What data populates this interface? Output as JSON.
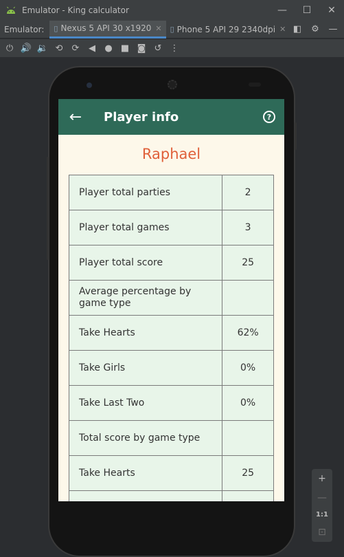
{
  "window": {
    "title": "Emulator - King calculator",
    "minimize_glyph": "—",
    "maximize_glyph": "☐",
    "close_glyph": "✕"
  },
  "tabs_bar": {
    "label": "Emulator:",
    "tabs": [
      {
        "label": "Nexus 5 API 30 x1920",
        "active": true
      },
      {
        "label": "Phone 5 API 29 2340dpi",
        "active": false
      }
    ],
    "close_glyph": "✕"
  },
  "toolbar": {
    "icons": [
      "power-icon",
      "volume-up-icon",
      "volume-down-icon",
      "rotate-left-icon",
      "rotate-right-icon",
      "back-icon",
      "home-icon",
      "overview-icon",
      "screenshot-icon",
      "snapshot-icon",
      "more-icon"
    ]
  },
  "app": {
    "title": "Player info",
    "back_glyph": "←",
    "help_glyph": "?",
    "player_name": "Raphael",
    "rows": [
      {
        "label": "Player total parties",
        "value": "2"
      },
      {
        "label": "Player total games",
        "value": "3"
      },
      {
        "label": "Player total score",
        "value": "25"
      },
      {
        "label": "Average percentage by game type",
        "value": ""
      },
      {
        "label": "Take Hearts",
        "value": "62%"
      },
      {
        "label": "Take Girls",
        "value": "0%"
      },
      {
        "label": "Take Last Two",
        "value": "0%"
      },
      {
        "label": "Total score by game type",
        "value": ""
      },
      {
        "label": "Take Hearts",
        "value": "25"
      },
      {
        "label": "",
        "value": ""
      }
    ]
  },
  "zoom_panel": {
    "zoom_in": "+",
    "zoom_out": "—",
    "one_to_one": "1:1"
  },
  "colors": {
    "app_bar": "#2e6a58",
    "player_name": "#e0603a",
    "screen_bg": "#fdf8ea",
    "cell_bg": "#e8f5e9",
    "active_tab_underline": "#4a88c7"
  }
}
